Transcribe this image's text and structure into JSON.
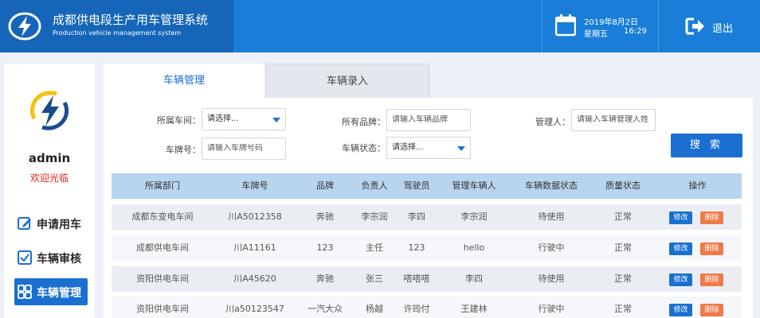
{
  "header": {
    "title_cn": "成都供电段生产用车管理系统",
    "title_en": "Production vehicle management system",
    "date": "2019年8月2日",
    "weekday": "星期五",
    "time": "16:29",
    "logout_label": "退出",
    "calendar_icon": "calendar-icon",
    "logout_icon": "logout-icon",
    "brand_color": "#1565b8",
    "bar_color": "#1a7ed8"
  },
  "sidebar": {
    "username": "admin",
    "welcome": "欢迎光临",
    "items": [
      {
        "label": "申请用车",
        "icon": "edit-icon",
        "active": false
      },
      {
        "label": "车辆审核",
        "icon": "checkbox-icon",
        "active": false
      },
      {
        "label": "车辆管理",
        "icon": "grid-icon",
        "active": true
      }
    ]
  },
  "tabs": [
    {
      "label": "车辆管理",
      "active": true
    },
    {
      "label": "车辆录入",
      "active": false
    }
  ],
  "filters": {
    "workshop_label": "所属车间：",
    "workshop_value": "请选择...",
    "brand_label": "所有品牌：",
    "brand_placeholder": "请输入车辆品牌",
    "manager_label": "管理人：",
    "manager_placeholder": "请输入车辆管理人姓",
    "plate_label": "车牌号：",
    "plate_placeholder": "请输入车牌号码",
    "status_label": "车辆状态：",
    "status_value": "请选择...",
    "search_label": "搜 索"
  },
  "table": {
    "columns": [
      "所属部门",
      "车牌号",
      "品牌",
      "负责人",
      "驾驶员",
      "管理车辆人",
      "车辆数据状态",
      "质量状态",
      "操作"
    ],
    "edit_label": "修改",
    "delete_label": "删除",
    "rows": [
      [
        "成都东变电车间",
        "川A5012358",
        "奔驰",
        "李宗润",
        "李四",
        "李宗润",
        "待使用",
        "正常"
      ],
      [
        "成都供电车间",
        "川A11161",
        "123",
        "主任",
        "123",
        "hello",
        "行驶中",
        "正常"
      ],
      [
        "资阳供电车间",
        "川A45620",
        "奔驰",
        "张三",
        "嗒嗒嗒",
        "李四",
        "待使用",
        "正常"
      ],
      [
        "资阳供电车间",
        "川a50123547",
        "一汽大众",
        "杨越",
        "许筠付",
        "王建林",
        "行驶中",
        "正常"
      ]
    ]
  }
}
